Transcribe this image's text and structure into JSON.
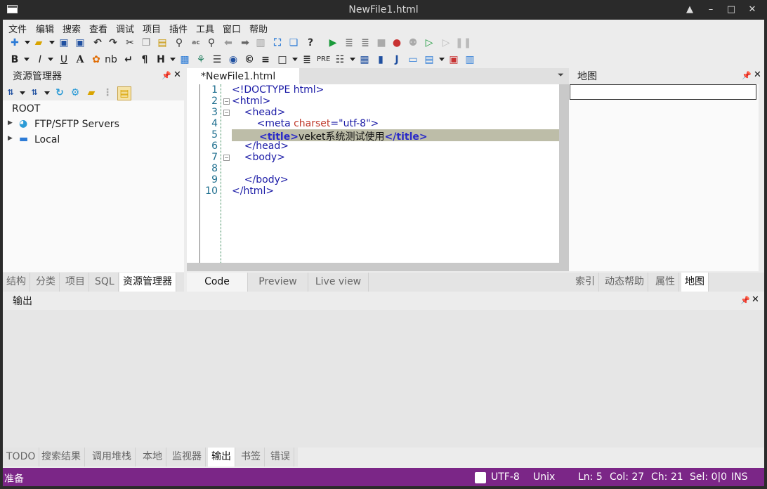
{
  "window": {
    "title": "NewFile1.html",
    "controls": [
      "▲",
      "–",
      "□",
      "✕"
    ]
  },
  "menubar": {
    "items": [
      "文件",
      "编辑",
      "搜索",
      "查看",
      "调试",
      "项目",
      "插件",
      "工具",
      "窗口",
      "帮助"
    ]
  },
  "toolbar": {
    "row2": {
      "bold": "B",
      "italic": "I",
      "underline": "U",
      "font": "A",
      "nbsp": "nb",
      "pilcrow": "¶",
      "heading": "H",
      "pre": "PRE",
      "jlabel": "J"
    }
  },
  "left_panel": {
    "title": "资源管理器",
    "tree": {
      "root": "ROOT",
      "items": [
        {
          "label": "FTP/SFTP Servers"
        },
        {
          "label": "Local"
        }
      ]
    },
    "tabs": [
      {
        "label": "结构"
      },
      {
        "label": "分类"
      },
      {
        "label": "项目"
      },
      {
        "label": "SQL"
      },
      {
        "label": "资源管理器",
        "active": true
      }
    ]
  },
  "editor": {
    "tab_label": "*NewFile1.html",
    "lines": [
      {
        "num": "1",
        "tokens": [
          {
            "t": "<!DOCTYPE html>",
            "c": "tag"
          }
        ]
      },
      {
        "num": "2",
        "tokens": [
          {
            "t": "<html>",
            "c": "tag"
          }
        ]
      },
      {
        "num": "3",
        "tokens": [
          {
            "t": "    <head>",
            "c": "tag"
          }
        ]
      },
      {
        "num": "4",
        "tokens": [
          {
            "t": "        <meta ",
            "c": "tag"
          },
          {
            "t": "charset",
            "c": "attr"
          },
          {
            "t": "=\"utf-8\">",
            "c": "val"
          }
        ]
      },
      {
        "num": "5",
        "tokens": [
          {
            "t": "        <title>",
            "c": "tag"
          },
          {
            "t": "veket系统测试使用",
            "c": "text"
          },
          {
            "t": "</title>",
            "c": "tag"
          }
        ]
      },
      {
        "num": "6",
        "tokens": [
          {
            "t": "    </head>",
            "c": "tag"
          }
        ]
      },
      {
        "num": "7",
        "tokens": [
          {
            "t": "    <body>",
            "c": "tag"
          }
        ]
      },
      {
        "num": "8",
        "tokens": []
      },
      {
        "num": "9",
        "tokens": [
          {
            "t": "    </body>",
            "c": "tag"
          }
        ]
      },
      {
        "num": "10",
        "tokens": [
          {
            "t": "</html>",
            "c": "tag"
          }
        ]
      }
    ],
    "view_tabs": [
      {
        "label": "Code",
        "active": true
      },
      {
        "label": "Preview"
      },
      {
        "label": "Live view"
      }
    ]
  },
  "right_panel": {
    "title": "地图",
    "tabs": [
      {
        "label": "索引"
      },
      {
        "label": "动态帮助"
      },
      {
        "label": "属性"
      },
      {
        "label": "地图",
        "active": true
      }
    ]
  },
  "output_panel": {
    "title": "输出",
    "tabs": [
      {
        "label": "TODO"
      },
      {
        "label": "搜索结果"
      },
      {
        "label": "调用堆栈"
      },
      {
        "label": "本地"
      },
      {
        "label": "监视器"
      },
      {
        "label": "输出",
        "active": true
      },
      {
        "label": "书签"
      },
      {
        "label": "错误"
      }
    ]
  },
  "statusbar": {
    "status": "准备",
    "encoding": "UTF-8",
    "line_ending": "Unix",
    "ln": "Ln: 5",
    "col": "Col: 27",
    "ch": "Ch: 21",
    "sel": "Sel: 0|0",
    "mode": "INS"
  },
  "colors": {
    "status_bg": "#7b2687",
    "tag": "#1a1aa6",
    "attr": "#c0392b",
    "highlight": "#bdbda8"
  }
}
